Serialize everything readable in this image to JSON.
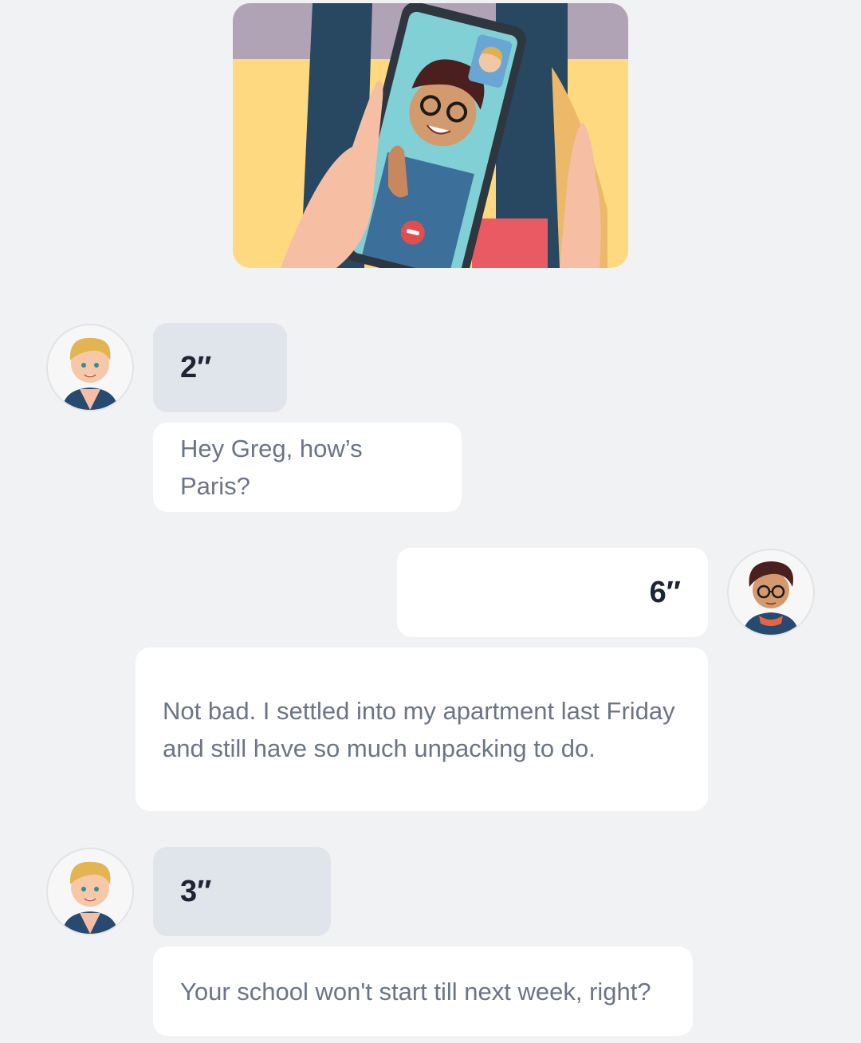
{
  "illustration": {
    "icon": "video-call-illustration"
  },
  "messages": [
    {
      "speaker": "blond-guy",
      "side": "left",
      "duration": "2″",
      "text": "Hey Greg, how’s Paris?"
    },
    {
      "speaker": "greg",
      "side": "right",
      "duration": "6″",
      "text": "Not bad. I settled into my apartment last Friday and still have so much unpacking to do."
    },
    {
      "speaker": "blond-guy",
      "side": "left",
      "duration": "3″",
      "text": "Your school won't start till next week, right?"
    }
  ],
  "colors": {
    "background": "#f1f2f4",
    "audio_bubble_left": "#e0e4eb",
    "bubble_white": "#ffffff",
    "duration_text": "#1d2433",
    "message_text": "#6b7586"
  }
}
